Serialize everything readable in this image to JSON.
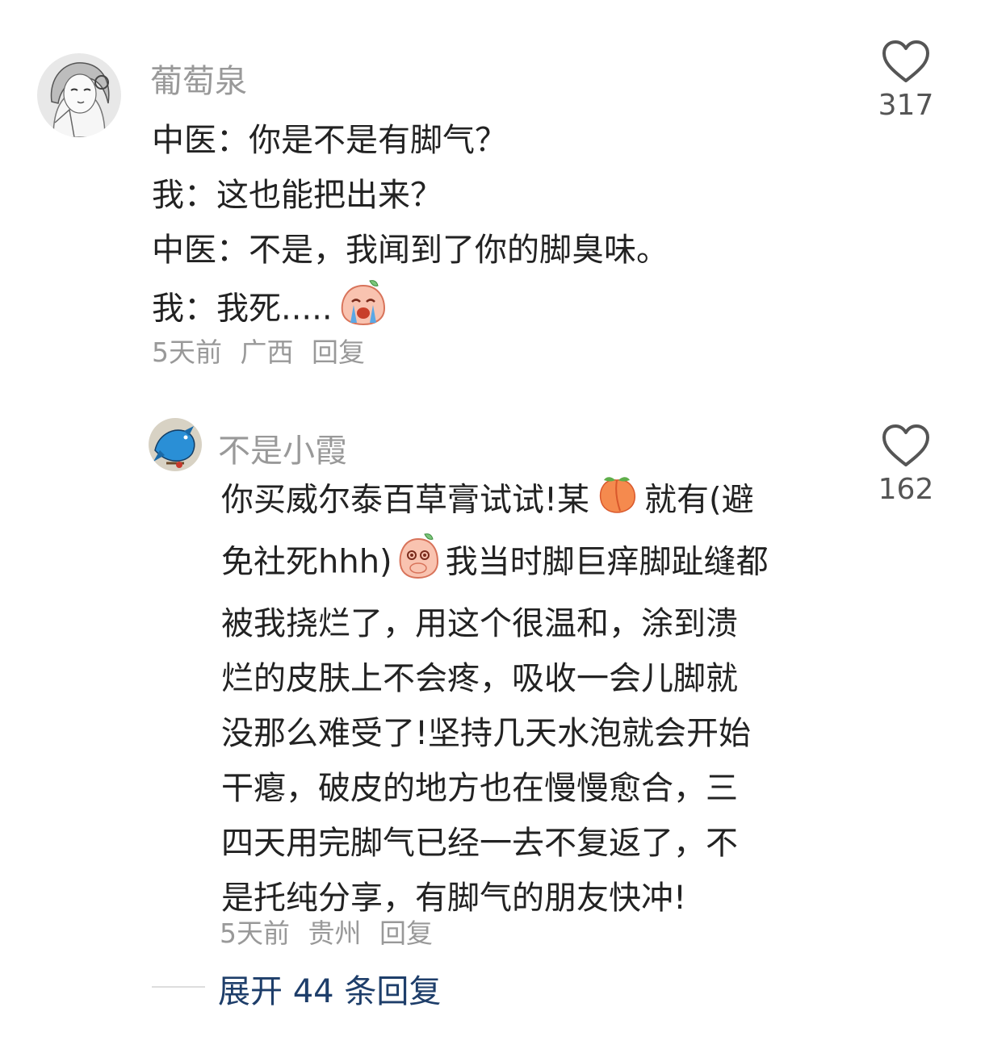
{
  "comments": [
    {
      "username": "葡萄泉",
      "lines": [
        "中医：你是不是有脚气？",
        "我：这也能把出来？",
        "中医：不是，我闻到了你的脚臭味。",
        "我：我死....."
      ],
      "emoji": "crying-peach-emoji",
      "time": "5天前",
      "location": "广西",
      "reply_label": "回复",
      "likes": "317"
    },
    {
      "username": "不是小霞",
      "lines": [
        "你买威尔泰百草膏试试!某",
        "就有(避",
        "免社死hhh)",
        "我当时脚巨痒脚趾缝都",
        "被我挠烂了，用这个很温和，涂到溃",
        "烂的皮肤上不会疼，吸收一会儿脚就",
        "没那么难受了!坚持几天水泡就会开始",
        "干瘪，破皮的地方也在慢慢愈合，三",
        "四天用完脚气已经一去不复返了，不",
        "是托纯分享，有脚气的朋友快冲!"
      ],
      "time": "5天前",
      "location": "贵州",
      "reply_label": "回复",
      "likes": "162"
    }
  ],
  "expand_replies": "展开 44 条回复",
  "icons": {
    "like": "heart-outline-icon",
    "emoji_1": "peach-emoji",
    "emoji_2": "shy-peach-emoji"
  },
  "colors": {
    "text": "#222222",
    "muted": "#999999",
    "link": "#1e3e6a"
  }
}
